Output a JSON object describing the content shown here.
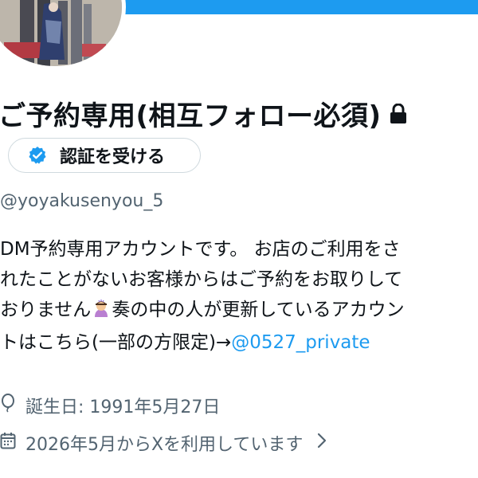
{
  "profile": {
    "display_name": "ご予約専用(相互フォロー必須)",
    "verify_button_label": "認証を受ける",
    "handle": "@yoyakusenyou_5"
  },
  "bio": {
    "line1": "DM予約専用アカウントです。 お店のご利用をさ",
    "line2": "れたことがないお客様からはご予約をお取りして",
    "line3_a": "おりません",
    "line3_b": "奏の中の人が更新しているアカウン",
    "line4_a": "トはこちら(一部の方限定)→",
    "line4_mention": "@0527_private"
  },
  "meta": {
    "birthday": "誕生日: 1991年5月27日",
    "joined": "2026年5月からXを利用しています"
  },
  "icons": {
    "lock": "lock-icon",
    "verified": "verified-badge-icon",
    "birthday": "balloon-icon",
    "calendar": "calendar-icon",
    "chevron": "chevron-right-icon",
    "emoji": "person-bowing-emoji"
  },
  "colors": {
    "accent": "#1d9bf0",
    "text": "#0f1419",
    "secondary": "#536471",
    "border": "#cfd9de"
  }
}
